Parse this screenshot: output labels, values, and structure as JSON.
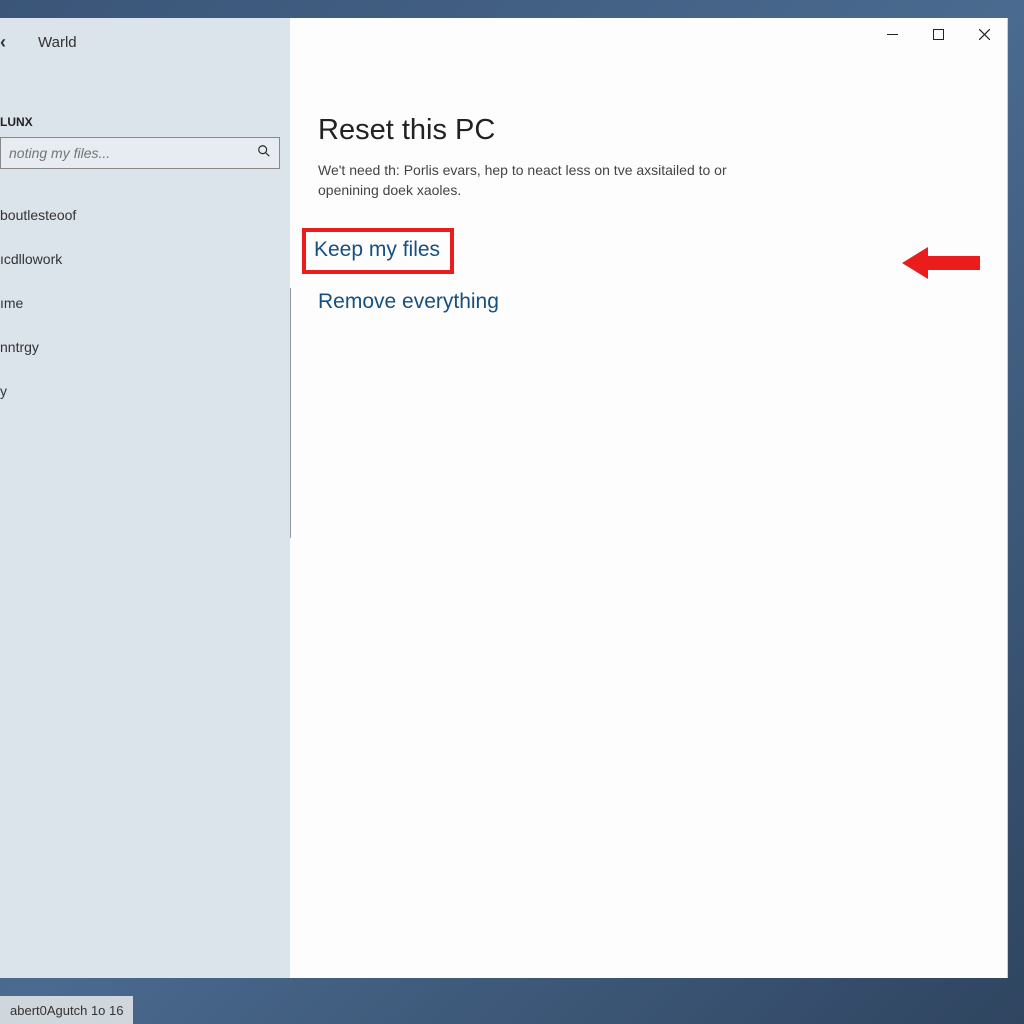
{
  "header": {
    "back_icon": "‹",
    "app_label": "Warld"
  },
  "sidebar": {
    "section_label": "LUNX",
    "search_placeholder": "noting my files...",
    "nav": [
      "boutlesteoof",
      "ıcdllowork",
      "ıme",
      "nntrgy",
      "y"
    ]
  },
  "main": {
    "title": "Reset this PC",
    "description": "We't need th: Porlis evars, hep to neact less on tve axsitailed to or openining doek xaoles.",
    "options": {
      "keep": "Keep my files",
      "remove": "Remove everything"
    }
  },
  "taskbar": {
    "badge": "abert0Agutch 1o 16"
  },
  "colors": {
    "accent_red": "#eb1c1c",
    "link_blue": "#164f80",
    "sidebar_bg": "#dbe3eb"
  }
}
